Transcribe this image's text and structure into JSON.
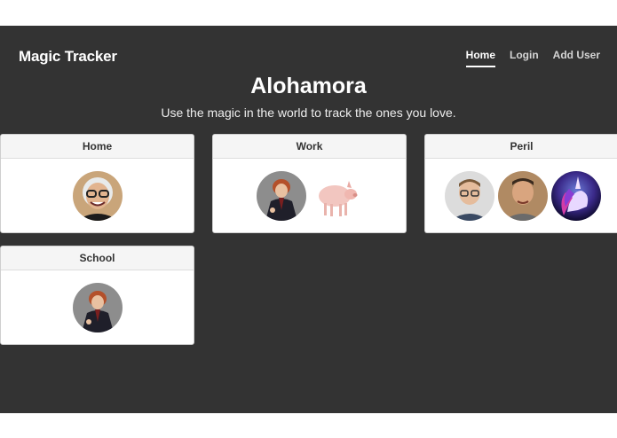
{
  "navbar": {
    "brand": "Magic Tracker",
    "links": [
      {
        "label": "Home",
        "active": true
      },
      {
        "label": "Login",
        "active": false
      },
      {
        "label": "Add User",
        "active": false
      }
    ]
  },
  "hero": {
    "title": "Alohamora",
    "subtitle": "Use the magic in the world to track the ones you love."
  },
  "locations": [
    {
      "name": "Home",
      "people": [
        "avatar-man-glasses-smiling"
      ]
    },
    {
      "name": "Work",
      "people": [
        "avatar-red-haired-wizard",
        "avatar-pig"
      ]
    },
    {
      "name": "Peril",
      "people": [
        "avatar-man-glasses",
        "avatar-man-short-hair",
        "avatar-unicorn"
      ]
    },
    {
      "name": "School",
      "people": [
        "avatar-red-haired-wizard"
      ]
    }
  ],
  "colors": {
    "background": "#333333",
    "navbar_text": "#ffffff",
    "card_header": "#f5f5f5"
  }
}
